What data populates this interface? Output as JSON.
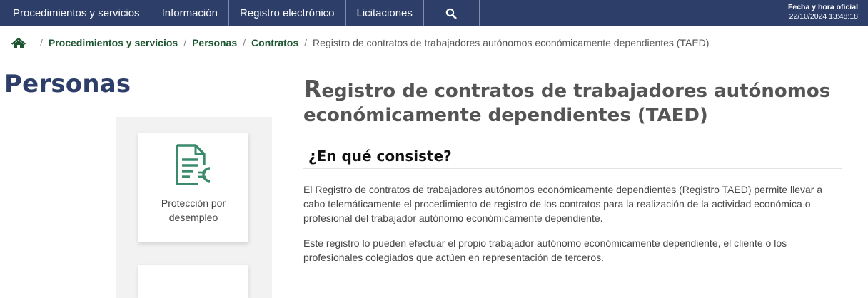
{
  "nav": {
    "items": [
      "Procedimientos y servicios",
      "Información",
      "Registro electrónico",
      "Licitaciones"
    ],
    "search_icon": "search-icon",
    "datetime_label": "Fecha y hora oficial",
    "datetime_value": "22/10/2024   13:48:18"
  },
  "breadcrumb": {
    "home_icon": "home-icon",
    "items": [
      "Procedimientos y servicios",
      "Personas",
      "Contratos"
    ],
    "current": "Registro de contratos de trabajadores autónomos económicamente dependientes (TAED)"
  },
  "sidebar": {
    "title": "Personas",
    "cards": [
      {
        "label": "Protección por desempleo",
        "icon": "document-euro-icon"
      }
    ]
  },
  "main": {
    "title_initial": "R",
    "title_rest": "egistro de contratos de trabajadores autónomos económicamente dependientes (TAED)",
    "section_heading": "¿En qué consiste?",
    "paragraphs": [
      "El Registro de contratos de trabajadores autónomos económicamente dependientes (Registro TAED) permite llevar a cabo telemáticamente el procedimiento de registro de los contratos para la realización de la actividad económica o profesional del trabajador autónomo económicamente dependiente.",
      "Este registro lo pueden efectuar el propio trabajador autónomo económicamente dependiente, el cliente o los profesionales colegiados que actúen en representación de terceros."
    ]
  },
  "colors": {
    "nav_bg": "#2d3f69",
    "breadcrumb_link": "#1e5631",
    "icon_green": "#3a8a6b"
  }
}
